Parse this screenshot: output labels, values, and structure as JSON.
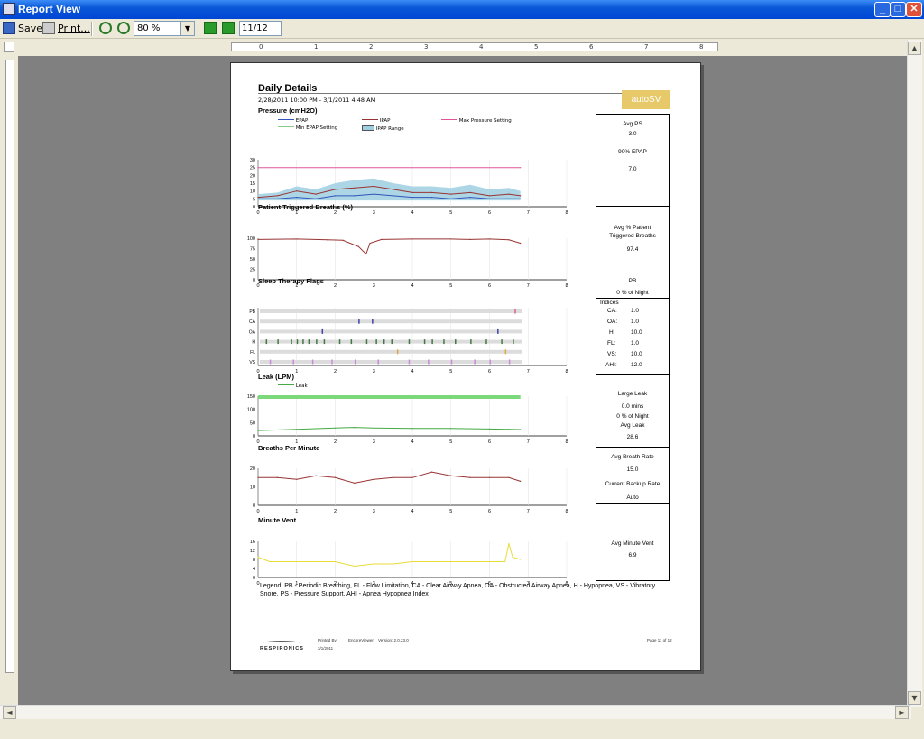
{
  "window": {
    "title": "Report View"
  },
  "toolbar": {
    "save_label": "Save",
    "print_label": "Print...",
    "zoom_value": "80 %",
    "page_value": "11/12"
  },
  "report": {
    "title": "Daily Details",
    "daterange": "2/28/2011 10:00 PM - 3/1/2011 4:48 AM",
    "logo": "autoSV",
    "sections": {
      "pressure": "Pressure (cmH2O)",
      "patient": "Patient Triggered Breaths (%)",
      "flags": "Sleep Therapy Flags",
      "leak": "Leak (LPM)",
      "bpm": "Breaths Per Minute",
      "mv": "Minute Vent"
    },
    "pressure_legend": {
      "epap": "EPAP",
      "ipap": "IPAP",
      "max": "Max Pressure Setting",
      "min_epap": "Min EPAP Setting",
      "ipap_range": "IPAP Range"
    },
    "leak_legend": "Leak",
    "stats": {
      "avg_ps_label": "Avg PS",
      "avg_ps": "3.0",
      "epap90_label": "90% EPAP",
      "epap90": "7.0",
      "patient_label_1": "Avg % Patient",
      "patient_label_2": "Triggered Breaths",
      "patient_value": "97.4",
      "pb_label": "PB",
      "pb_value": "0 % of Night",
      "indices_label": "Indices",
      "indices": [
        [
          "CA:",
          "1.0"
        ],
        [
          "OA:",
          "1.0"
        ],
        [
          "H:",
          "10.0"
        ],
        [
          "FL:",
          "1.0"
        ],
        [
          "VS:",
          "10.0"
        ],
        [
          "AHI:",
          "12.0"
        ]
      ],
      "large_leak_label": "Large Leak",
      "large_leak_mins": "0.0 mins",
      "large_leak_pct": "0 % of Night",
      "avg_leak_label": "Avg Leak",
      "avg_leak": "28.6",
      "avg_br_label": "Avg Breath Rate",
      "avg_br": "15.0",
      "backup_label": "Current Backup Rate",
      "backup": "Auto",
      "avg_mv_label": "Avg Minute Vent",
      "avg_mv": "6.9"
    },
    "legend": "Legend: PB - Periodic Breathing, FL - Flow Limitation, CA - Clear Airway Apnea, OA - Obstructed Airway Apnea, H - Hypopnea, VS - Vibratory Snore, PS - Pressure Support, AHI - Apnea Hypopnea Index",
    "footer": {
      "brand": "RESPIRONICS",
      "printed_by": "Printed By:",
      "printed_date": "3/1/2011",
      "viewer": "EncoreViewer",
      "version": "Version: 2.0.23.0",
      "page": "Page 11 of 12"
    }
  },
  "chart_data": [
    {
      "type": "line",
      "title": "Pressure (cmH2O)",
      "xlim": [
        0,
        8
      ],
      "ylim": [
        0,
        30
      ],
      "x_ticks": [
        "0",
        "1",
        "2",
        "3",
        "4",
        "5",
        "6",
        "7",
        "8"
      ],
      "y_ticks": [
        "0",
        "5",
        "10",
        "15",
        "20",
        "25",
        "30"
      ],
      "series": [
        {
          "name": "Max Pressure Setting",
          "color": "#e0559a",
          "x": [
            0,
            6.8
          ],
          "y": [
            25,
            25
          ]
        },
        {
          "name": "EPAP",
          "color": "#3355bb",
          "x": [
            0,
            0.5,
            1,
            1.5,
            2,
            2.5,
            3,
            3.5,
            4,
            4.5,
            5,
            5.5,
            6,
            6.5,
            6.8
          ],
          "y": [
            5,
            5,
            6,
            5,
            7,
            7,
            8,
            7,
            6,
            6,
            5,
            6,
            5,
            5,
            5
          ]
        },
        {
          "name": "IPAP",
          "color": "#993333",
          "x": [
            0,
            0.5,
            1,
            1.5,
            2,
            2.5,
            3,
            3.5,
            4,
            4.5,
            5,
            5.5,
            6,
            6.5,
            6.8
          ],
          "y": [
            6,
            7,
            10,
            8,
            11,
            12,
            13,
            11,
            9,
            9,
            8,
            9,
            7,
            8,
            7
          ]
        },
        {
          "name": "IPAP Range",
          "color": "#9ecfe0",
          "x": [
            0,
            0.5,
            1,
            1.5,
            2,
            2.5,
            3,
            3.5,
            4,
            4.5,
            5,
            5.5,
            6,
            6.5,
            6.8
          ],
          "y": [
            8,
            9,
            13,
            11,
            15,
            17,
            18,
            15,
            13,
            13,
            12,
            14,
            11,
            12,
            10
          ]
        }
      ]
    },
    {
      "type": "line",
      "title": "Patient Triggered Breaths (%)",
      "xlim": [
        0,
        8
      ],
      "ylim": [
        0,
        100
      ],
      "x_ticks": [
        "0",
        "1",
        "2",
        "3",
        "4",
        "5",
        "6",
        "7",
        "8"
      ],
      "y_ticks": [
        "0",
        "25",
        "50",
        "75",
        "100"
      ],
      "series": [
        {
          "name": "",
          "color": "#993333",
          "x": [
            0,
            1,
            1.8,
            2.2,
            2.6,
            2.8,
            2.9,
            3.2,
            4,
            5,
            5.5,
            6,
            6.5,
            6.8
          ],
          "y": [
            97,
            98,
            96,
            95,
            80,
            62,
            88,
            97,
            98,
            98,
            97,
            98,
            96,
            88
          ]
        }
      ]
    },
    {
      "type": "scatter",
      "title": "Sleep Therapy Flags",
      "xlim": [
        0,
        8
      ],
      "categories": [
        "PB",
        "CA",
        "OA",
        "H",
        "FL",
        "VS"
      ],
      "x_ticks": [
        "0",
        "1",
        "2",
        "3",
        "4",
        "5",
        "6",
        "7",
        "8"
      ]
    },
    {
      "type": "line",
      "title": "Leak (LPM)",
      "xlim": [
        0,
        8
      ],
      "ylim": [
        0,
        150
      ],
      "x_ticks": [
        "0",
        "1",
        "2",
        "3",
        "4",
        "5",
        "6",
        "7",
        "8"
      ],
      "y_ticks": [
        "0",
        "50",
        "100",
        "150"
      ],
      "series": [
        {
          "name": "Leak",
          "color": "#44aa44",
          "x": [
            0,
            1,
            2,
            2.5,
            3,
            4,
            5,
            6,
            6.5,
            6.8
          ],
          "y": [
            20,
            25,
            30,
            32,
            30,
            28,
            28,
            26,
            25,
            24
          ]
        }
      ]
    },
    {
      "type": "line",
      "title": "Breaths Per Minute",
      "xlim": [
        0,
        8
      ],
      "ylim": [
        0,
        20
      ],
      "x_ticks": [
        "0",
        "1",
        "2",
        "3",
        "4",
        "5",
        "6",
        "7",
        "8"
      ],
      "y_ticks": [
        "0",
        "10",
        "20"
      ],
      "series": [
        {
          "name": "",
          "color": "#993333",
          "x": [
            0,
            0.5,
            1,
            1.5,
            2,
            2.5,
            3,
            3.5,
            4,
            4.5,
            5,
            5.5,
            6,
            6.5,
            6.8
          ],
          "y": [
            15,
            15,
            14,
            16,
            15,
            12,
            14,
            15,
            15,
            18,
            16,
            15,
            15,
            15,
            13
          ]
        }
      ]
    },
    {
      "type": "line",
      "title": "Minute Vent",
      "xlim": [
        0,
        8
      ],
      "ylim": [
        0,
        16
      ],
      "x_ticks": [
        "0",
        "1",
        "2",
        "3",
        "4",
        "5",
        "6",
        "7",
        "8"
      ],
      "y_ticks": [
        "0",
        "4",
        "8",
        "12",
        "16"
      ],
      "series": [
        {
          "name": "",
          "color": "#e8dc3a",
          "x": [
            0,
            0.3,
            1,
            1.5,
            2,
            2.5,
            3,
            3.5,
            4,
            4.5,
            5,
            5.5,
            6,
            6.4,
            6.5,
            6.6,
            6.8
          ],
          "y": [
            9,
            7,
            7,
            7,
            7,
            5,
            6,
            6,
            7,
            7,
            7,
            7,
            7,
            7,
            15,
            9,
            8
          ]
        }
      ]
    }
  ]
}
